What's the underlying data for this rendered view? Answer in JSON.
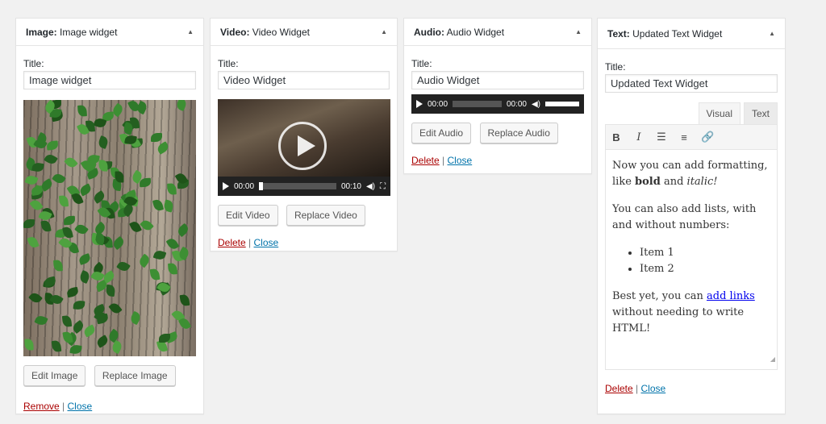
{
  "image_widget": {
    "type_label": "Image:",
    "name": "Image widget",
    "title_label": "Title:",
    "title_value": "Image widget",
    "edit_button": "Edit Image",
    "replace_button": "Replace Image",
    "remove_link": "Remove",
    "separator": "|",
    "close_link": "Close"
  },
  "video_widget": {
    "type_label": "Video:",
    "name": "Video Widget",
    "title_label": "Title:",
    "title_value": "Video Widget",
    "time_current": "00:00",
    "time_total": "00:10",
    "edit_button": "Edit Video",
    "replace_button": "Replace Video",
    "delete_link": "Delete",
    "separator": "|",
    "close_link": "Close"
  },
  "audio_widget": {
    "type_label": "Audio:",
    "name": "Audio Widget",
    "title_label": "Title:",
    "title_value": "Audio Widget",
    "time_current": "00:00",
    "time_total": "00:00",
    "edit_button": "Edit Audio",
    "replace_button": "Replace Audio",
    "delete_link": "Delete",
    "separator": "|",
    "close_link": "Close"
  },
  "text_widget": {
    "type_label": "Text:",
    "name": "Updated Text Widget",
    "title_label": "Title:",
    "title_value": "Updated Text Widget",
    "tab_visual": "Visual",
    "tab_text": "Text",
    "toolbar": {
      "bold": "B",
      "italic": "I",
      "bullet_list": "bullet-list-icon",
      "numbered_list": "numbered-list-icon",
      "link": "link-icon"
    },
    "content": {
      "p1_pre": "Now you can add formatting, like ",
      "p1_bold": "bold",
      "p1_mid": " and ",
      "p1_italic": "italic!",
      "p2": "You can also add lists, with and without numbers:",
      "items": [
        "Item 1",
        "Item 2"
      ],
      "p3_pre": "Best yet, you can ",
      "p3_link": "add links",
      "p3_post": " without needing to write HTML!"
    },
    "delete_link": "Delete",
    "separator": "|",
    "close_link": "Close"
  },
  "colors": {
    "background": "#f1f1f1",
    "delete_link": "#aa0000",
    "close_link": "#0073aa"
  }
}
